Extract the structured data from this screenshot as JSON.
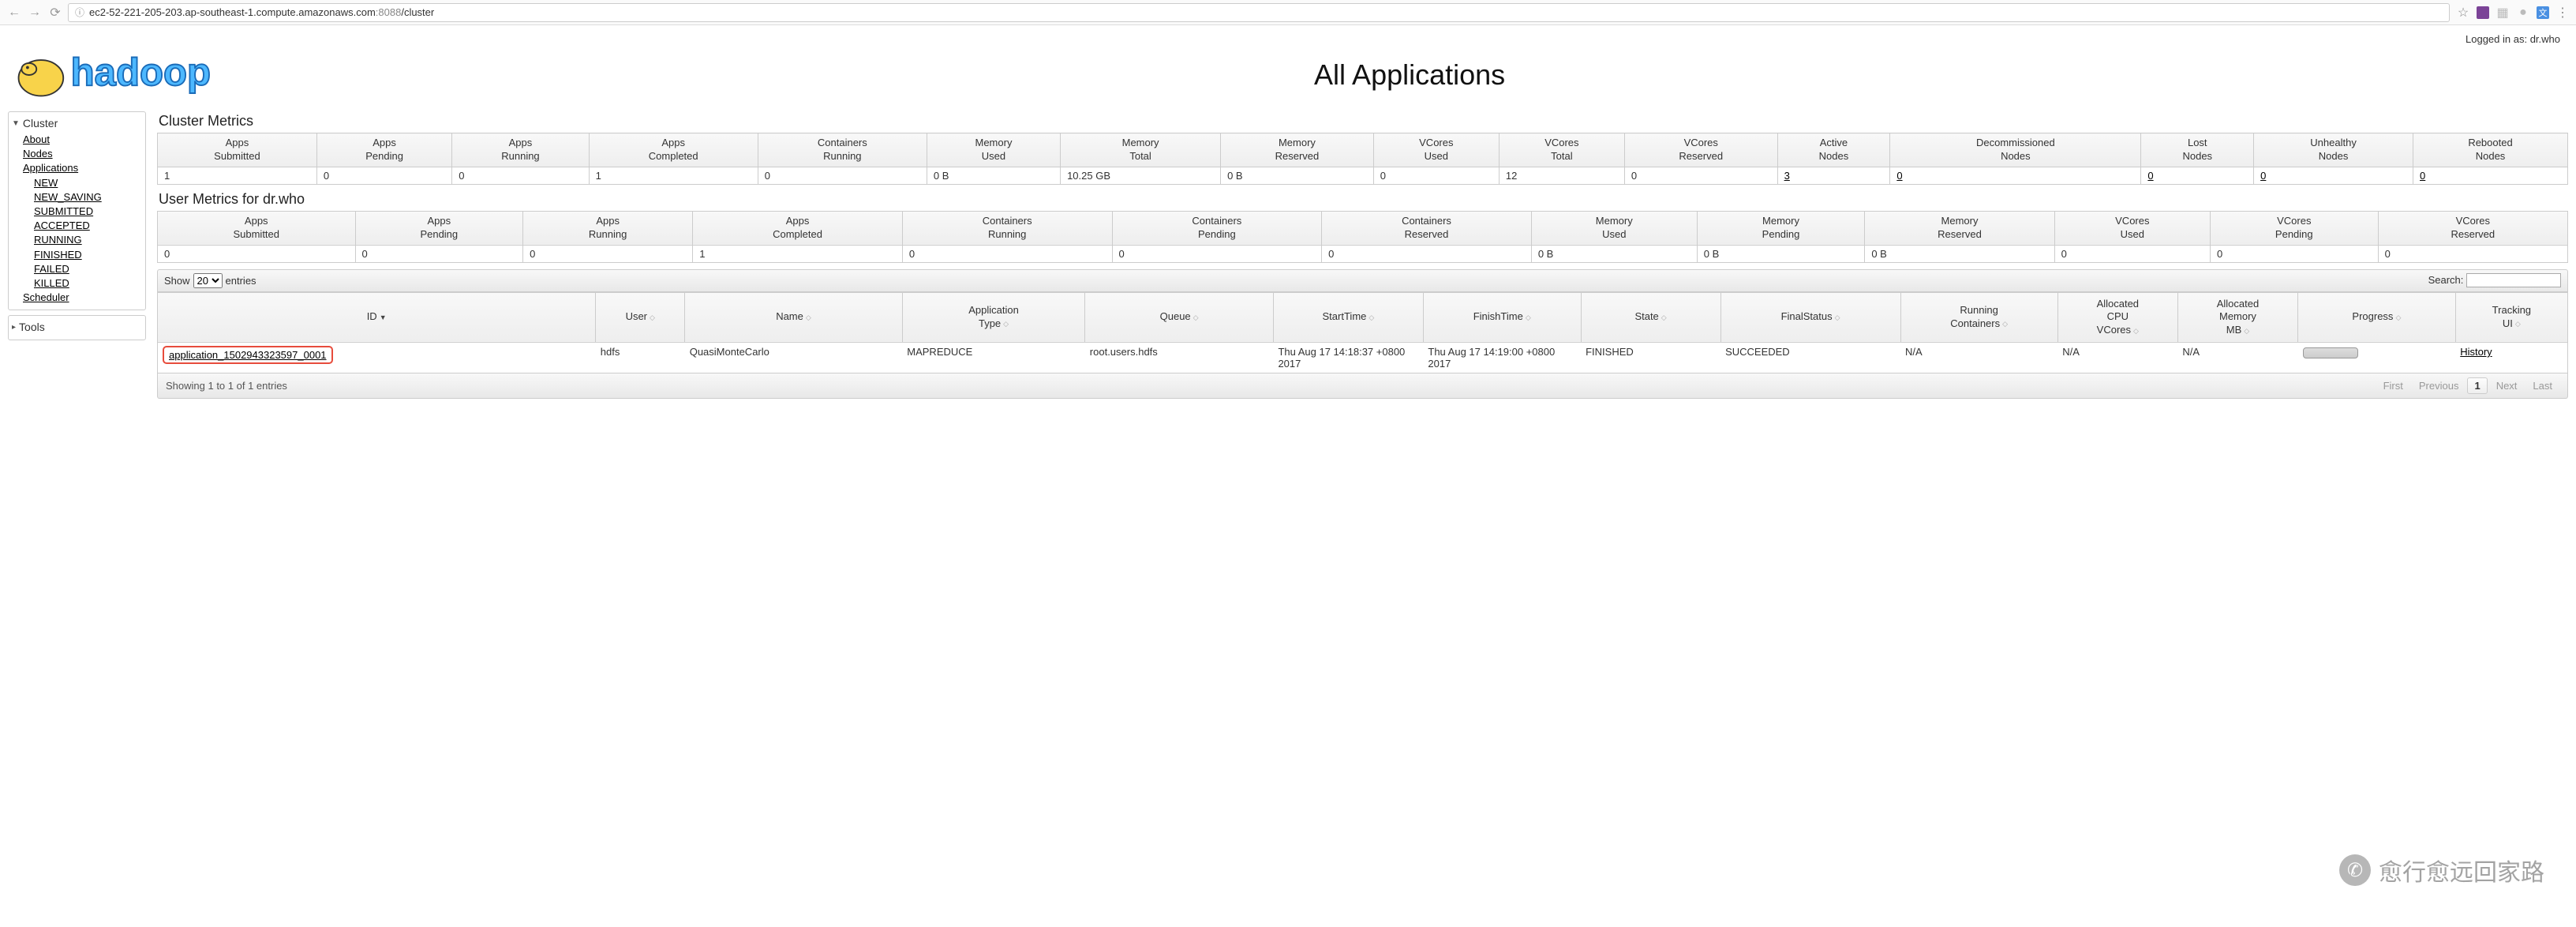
{
  "browser": {
    "url_prefix": "ec2-52-221-205-203.ap-southeast-1.compute.amazonaws.com",
    "url_port": ":8088",
    "url_path": "/cluster"
  },
  "login_text": "Logged in as: dr.who",
  "page_title": "All Applications",
  "sidebar": {
    "cluster_label": "Cluster",
    "about": "About",
    "nodes": "Nodes",
    "applications": "Applications",
    "states": [
      "NEW",
      "NEW_SAVING",
      "SUBMITTED",
      "ACCEPTED",
      "RUNNING",
      "FINISHED",
      "FAILED",
      "KILLED"
    ],
    "scheduler": "Scheduler",
    "tools_label": "Tools"
  },
  "cluster_metrics": {
    "title": "Cluster Metrics",
    "headers": [
      "Apps Submitted",
      "Apps Pending",
      "Apps Running",
      "Apps Completed",
      "Containers Running",
      "Memory Used",
      "Memory Total",
      "Memory Reserved",
      "VCores Used",
      "VCores Total",
      "VCores Reserved",
      "Active Nodes",
      "Decommissioned Nodes",
      "Lost Nodes",
      "Unhealthy Nodes",
      "Rebooted Nodes"
    ],
    "values": [
      "1",
      "0",
      "0",
      "1",
      "0",
      "0 B",
      "10.25 GB",
      "0 B",
      "0",
      "12",
      "0",
      "3",
      "0",
      "0",
      "0",
      "0"
    ],
    "link_indices": [
      11,
      12,
      13,
      14,
      15
    ]
  },
  "user_metrics": {
    "title": "User Metrics for dr.who",
    "headers": [
      "Apps Submitted",
      "Apps Pending",
      "Apps Running",
      "Apps Completed",
      "Containers Running",
      "Containers Pending",
      "Containers Reserved",
      "Memory Used",
      "Memory Pending",
      "Memory Reserved",
      "VCores Used",
      "VCores Pending",
      "VCores Reserved"
    ],
    "values": [
      "0",
      "0",
      "0",
      "1",
      "0",
      "0",
      "0",
      "0 B",
      "0 B",
      "0 B",
      "0",
      "0",
      "0"
    ]
  },
  "controls": {
    "show": "Show",
    "entries": "entries",
    "length": "20",
    "search": "Search:"
  },
  "apps": {
    "headers": [
      "ID",
      "User",
      "Name",
      "Application Type",
      "Queue",
      "StartTime",
      "FinishTime",
      "State",
      "FinalStatus",
      "Running Containers",
      "Allocated CPU VCores",
      "Allocated Memory MB",
      "Progress",
      "Tracking UI"
    ],
    "row": {
      "id": "application_1502943323597_0001",
      "user": "hdfs",
      "name": "QuasiMonteCarlo",
      "type": "MAPREDUCE",
      "queue": "root.users.hdfs",
      "start": "Thu Aug 17 14:18:37 +0800 2017",
      "finish": "Thu Aug 17 14:19:00 +0800 2017",
      "state": "FINISHED",
      "final": "SUCCEEDED",
      "rc": "N/A",
      "cpu": "N/A",
      "mem": "N/A",
      "tracking": "History"
    }
  },
  "footer": {
    "info": "Showing 1 to 1 of 1 entries",
    "first": "First",
    "prev": "Previous",
    "page": "1",
    "next": "Next",
    "last": "Last"
  },
  "watermark": "愈行愈远回家路"
}
